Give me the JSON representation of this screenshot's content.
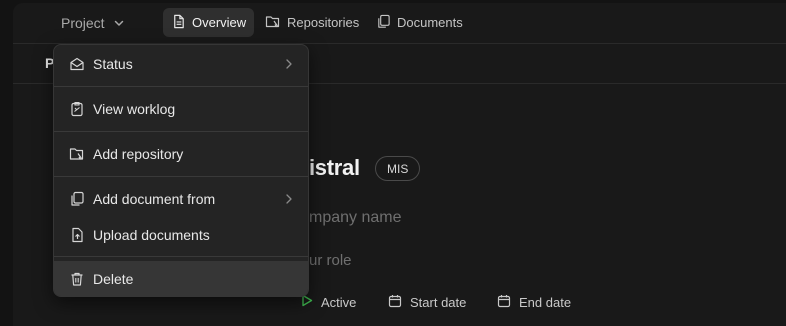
{
  "header": {
    "project_label": "Project",
    "tabs": [
      {
        "label": "Overview",
        "active": true
      },
      {
        "label": "Repositories"
      },
      {
        "label": "Documents"
      }
    ]
  },
  "subheader": {
    "tab_partial": "P"
  },
  "main": {
    "title_visible": "istral",
    "badge": "MIS",
    "company_placeholder_visible": "mpany name",
    "role_placeholder_visible": "ur role",
    "status": "Active",
    "start_date": "Start date",
    "end_date": "End date"
  },
  "menu": {
    "items": [
      {
        "label": "Status",
        "icon": "envelope-open-icon",
        "submenu": true
      },
      {
        "label": "View worklog",
        "icon": "worklog-icon"
      },
      {
        "label": "Add repository",
        "icon": "add-repository-icon"
      },
      {
        "label": "Add document from",
        "icon": "copy-document-icon",
        "submenu": true
      },
      {
        "label": "Upload documents",
        "icon": "upload-document-icon"
      },
      {
        "label": "Delete",
        "icon": "trash-icon",
        "highlighted": true
      }
    ]
  },
  "colors": {
    "background": "#131313",
    "panel": "#191919",
    "menu_bg": "#242424",
    "highlight": "#363636",
    "active_green": "#3fb950"
  }
}
